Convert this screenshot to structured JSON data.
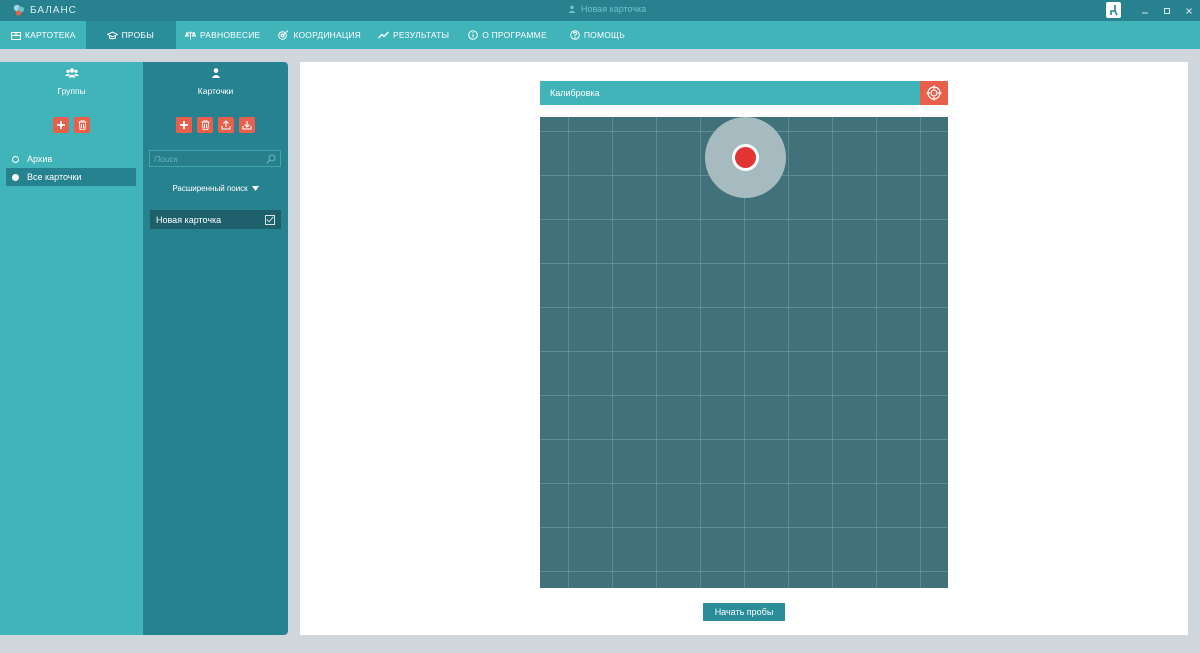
{
  "app": {
    "brand": "БАЛАНС",
    "window_title": "Новая карточка"
  },
  "colors": {
    "teal_dark": "#27818f",
    "teal": "#41b4ba",
    "accent": "#e8604c",
    "marker": "#e23335",
    "plot_bg": "#41727c"
  },
  "menu": [
    {
      "label": "КАРТОТЕКА",
      "icon": "cabinet-icon"
    },
    {
      "label": "ПРОБЫ",
      "icon": "graduation-icon"
    },
    {
      "label": "РАВНОВЕСИЕ",
      "icon": "scales-icon"
    },
    {
      "label": "КООРДИНАЦИЯ",
      "icon": "target-arrow-icon"
    },
    {
      "label": "РЕЗУЛЬТАТЫ",
      "icon": "trend-icon"
    },
    {
      "label": "О ПРОГРАММЕ",
      "icon": "info-icon"
    },
    {
      "label": "ПОМОЩЬ",
      "icon": "help-icon"
    }
  ],
  "active_menu": "ПРОБЫ",
  "groups": {
    "title": "Группы",
    "items": [
      {
        "label": "Архив",
        "selected": false
      },
      {
        "label": "Все карточки",
        "selected": true
      }
    ]
  },
  "cards": {
    "title": "Карточки",
    "search_placeholder": "Поиск",
    "advanced_search": "Расширенный поиск",
    "items": [
      {
        "label": "Новая карточка",
        "checked": true
      }
    ]
  },
  "calibration": {
    "title": "Калибровка"
  },
  "start_button": "Начать пробы"
}
